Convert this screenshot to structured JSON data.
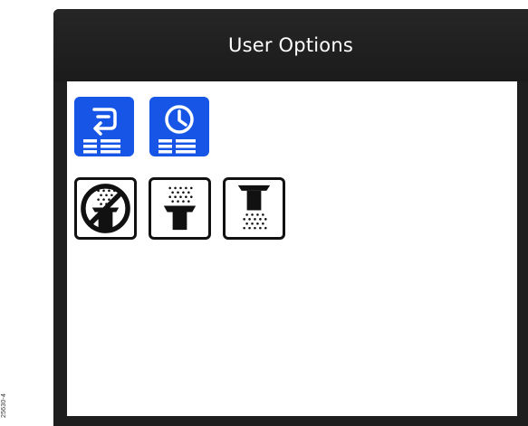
{
  "figure_id": "25630-4",
  "header": {
    "title": "User Options"
  },
  "options": [
    {
      "icon": "return-list-icon",
      "style": "selected",
      "color": "#1655e6"
    },
    {
      "icon": "clock-list-icon",
      "style": "selected",
      "color": "#1655e6"
    },
    {
      "icon": "no-dispense-icon",
      "style": "outline"
    },
    {
      "icon": "top-dispense-icon",
      "style": "outline"
    },
    {
      "icon": "bottom-dispense-icon",
      "style": "outline"
    }
  ]
}
